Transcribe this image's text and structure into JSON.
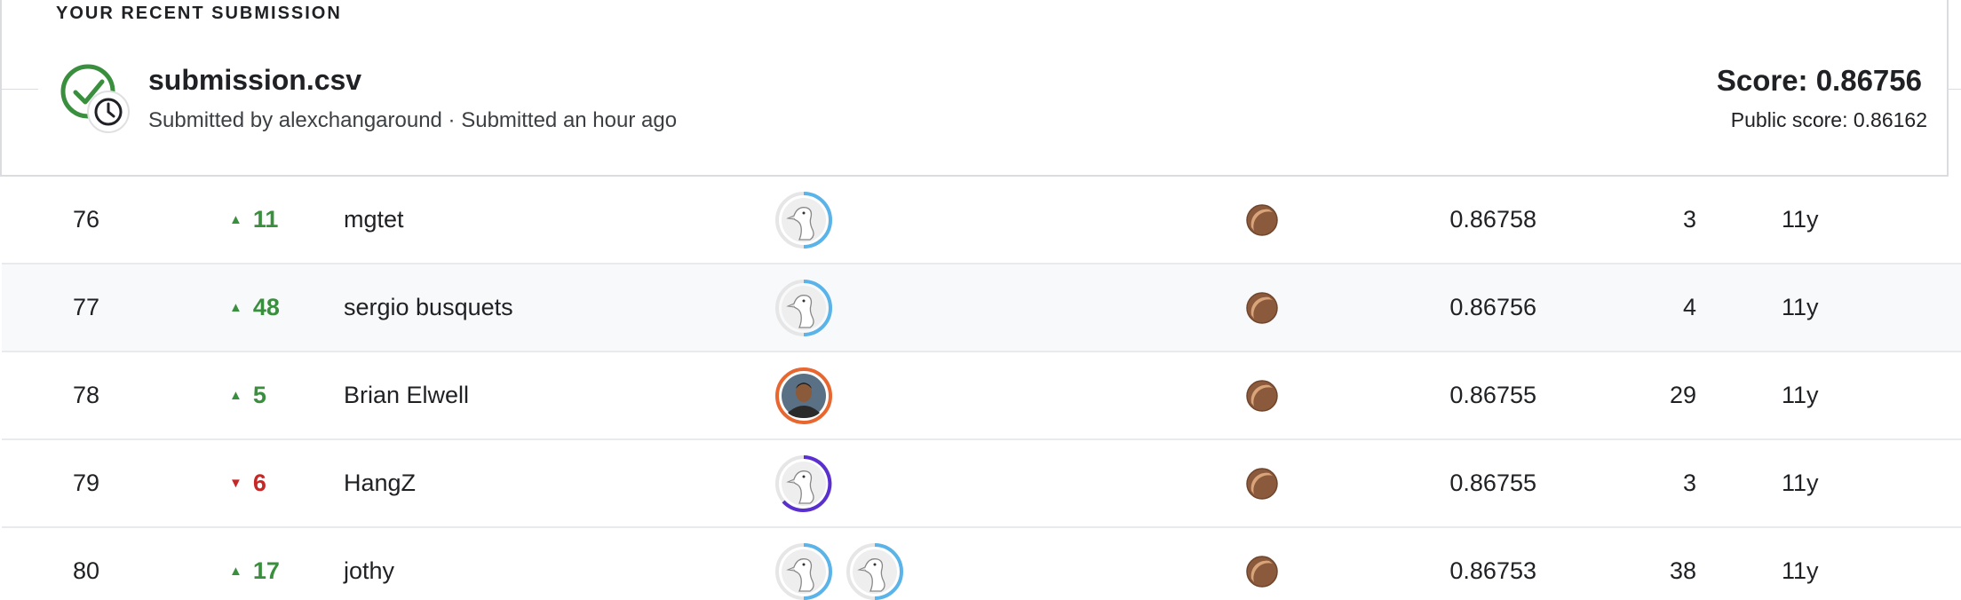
{
  "section": {
    "title": "YOUR RECENT SUBMISSION"
  },
  "submission": {
    "file_name": "submission.csv",
    "meta": "Submitted by alexchangaround · Submitted an hour ago",
    "score": "Score: 0.86756",
    "public_score": "Public score: 0.86162",
    "status_icon": "check-clock-icon"
  },
  "colors": {
    "up": "#3a8f3e",
    "down": "#c62828",
    "bronze": "#8b5a3c",
    "tier_blue": "#5ab4ea",
    "tier_orange": "#e8662f",
    "tier_purple": "#5a2fd0"
  },
  "leaderboard": {
    "rows": [
      {
        "rank": "76",
        "direction": "up",
        "change": "11",
        "team": "mgtet",
        "score": "0.86758",
        "entries": "3",
        "last": "11y",
        "members": [
          {
            "avatar": "default-avatar-icon",
            "tier": "blue"
          }
        ],
        "medal": "bronze-medal-icon"
      },
      {
        "rank": "77",
        "direction": "up",
        "change": "48",
        "team": "sergio busquets",
        "score": "0.86756",
        "entries": "4",
        "last": "11y",
        "members": [
          {
            "avatar": "default-avatar-icon",
            "tier": "blue"
          }
        ],
        "medal": "bronze-medal-icon"
      },
      {
        "rank": "78",
        "direction": "up",
        "change": "5",
        "team": "Brian Elwell",
        "score": "0.86755",
        "entries": "29",
        "last": "11y",
        "members": [
          {
            "avatar": "photo-avatar-icon",
            "tier": "orange"
          }
        ],
        "medal": "bronze-medal-icon"
      },
      {
        "rank": "79",
        "direction": "down",
        "change": "6",
        "team": "HangZ",
        "score": "0.86755",
        "entries": "3",
        "last": "11y",
        "members": [
          {
            "avatar": "default-avatar-icon",
            "tier": "purple"
          }
        ],
        "medal": "bronze-medal-icon"
      },
      {
        "rank": "80",
        "direction": "up",
        "change": "17",
        "team": "jothy",
        "score": "0.86753",
        "entries": "38",
        "last": "11y",
        "members": [
          {
            "avatar": "default-avatar-icon",
            "tier": "blue"
          },
          {
            "avatar": "default-avatar-icon",
            "tier": "blue"
          }
        ],
        "medal": "bronze-medal-icon"
      }
    ]
  }
}
